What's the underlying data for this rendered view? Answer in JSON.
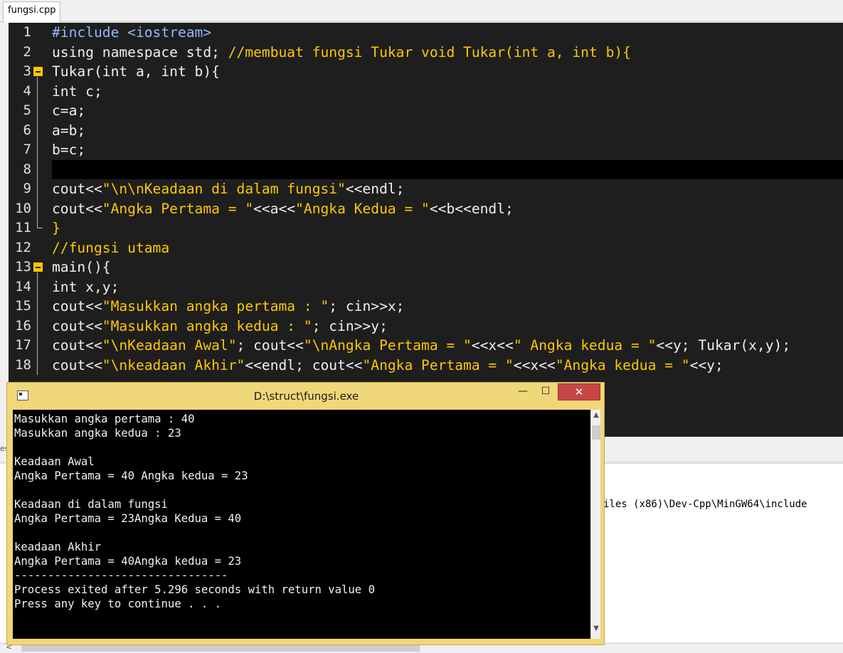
{
  "ide": {
    "tab_label": "fungsi.cpp",
    "lines": [
      {
        "n": "1",
        "parts": [
          [
            "kw",
            "#include <iostream>"
          ]
        ]
      },
      {
        "n": "2",
        "parts": [
          [
            "",
            "using namespace std; "
          ],
          [
            "cmt",
            "//membuat fungsi Tukar void Tukar(int a, int b){"
          ]
        ]
      },
      {
        "n": "3",
        "parts": [
          [
            "",
            "Tukar(int a, int b){"
          ]
        ],
        "fold": "open"
      },
      {
        "n": "4",
        "parts": [
          [
            "",
            "int c;"
          ]
        ]
      },
      {
        "n": "5",
        "parts": [
          [
            "",
            "c=a;"
          ]
        ]
      },
      {
        "n": "6",
        "parts": [
          [
            "",
            "a=b;"
          ]
        ]
      },
      {
        "n": "7",
        "parts": [
          [
            "",
            "b=c;"
          ]
        ]
      },
      {
        "n": "8",
        "parts": [
          [
            "",
            ""
          ]
        ],
        "active": true
      },
      {
        "n": "9",
        "parts": [
          [
            "",
            "cout<<"
          ],
          [
            "str",
            "\"\\n\\nKeadaan di dalam fungsi\""
          ],
          [
            "",
            "<<endl;"
          ]
        ]
      },
      {
        "n": "10",
        "parts": [
          [
            "",
            "cout<<"
          ],
          [
            "str",
            "\"Angka Pertama = \""
          ],
          [
            "",
            "<<a<<"
          ],
          [
            "str",
            "\"Angka Kedua = \""
          ],
          [
            "",
            "<<b<<endl;"
          ]
        ]
      },
      {
        "n": "11",
        "parts": [
          [
            "str",
            "}"
          ]
        ],
        "fold": "end"
      },
      {
        "n": "12",
        "parts": [
          [
            "cmt",
            "//fungsi utama"
          ]
        ]
      },
      {
        "n": "13",
        "parts": [
          [
            "",
            "main(){"
          ]
        ],
        "fold": "open"
      },
      {
        "n": "14",
        "parts": [
          [
            "",
            "int x,y;"
          ]
        ]
      },
      {
        "n": "15",
        "parts": [
          [
            "",
            "cout<<"
          ],
          [
            "str",
            "\"Masukkan angka pertama : \""
          ],
          [
            "",
            "; cin>>x;"
          ]
        ]
      },
      {
        "n": "16",
        "parts": [
          [
            "",
            "cout<<"
          ],
          [
            "str",
            "\"Masukkan angka kedua : \""
          ],
          [
            "",
            "; cin>>y;"
          ]
        ]
      },
      {
        "n": "17",
        "parts": [
          [
            "",
            "cout<<"
          ],
          [
            "str",
            "\"\\nKeadaan Awal\""
          ],
          [
            "",
            "; cout<<"
          ],
          [
            "str",
            "\"\\nAngka Pertama = \""
          ],
          [
            "",
            "<<x<<"
          ],
          [
            "str",
            "\" Angka kedua = \""
          ],
          [
            "",
            "<<y; Tukar(x,y);"
          ]
        ]
      },
      {
        "n": "18",
        "parts": [
          [
            "",
            "cout<<"
          ],
          [
            "str",
            "\"\\nkeadaan Akhir\""
          ],
          [
            "",
            "<<endl; cout<<"
          ],
          [
            "str",
            "\"Angka Pertama = \""
          ],
          [
            "",
            "<<x<<"
          ],
          [
            "str",
            "\"Angka kedua = \""
          ],
          [
            "",
            "<<y;"
          ]
        ]
      }
    ],
    "log_text": "iles (x86)\\Dev-Cpp\\MinGW64\\include"
  },
  "console": {
    "title": "D:\\struct\\fungsi.exe",
    "minimize_label": "—",
    "maximize_label": "☐",
    "close_label": "✕",
    "output": [
      "Masukkan angka pertama : 40",
      "Masukkan angka kedua : 23",
      "",
      "Keadaan Awal",
      "Angka Pertama = 40 Angka kedua = 23",
      "",
      "Keadaan di dalam fungsi",
      "Angka Pertama = 23Angka Kedua = 40",
      "",
      "keadaan Akhir",
      "Angka Pertama = 40Angka kedua = 23",
      "--------------------------------",
      "Process exited after 5.296 seconds with return value 0",
      "Press any key to continue . . ."
    ]
  },
  "icons": {
    "fold_open": "fold-minus-icon",
    "console_app": "console-window-icon",
    "scroll_up": "▲",
    "scroll_down": "▼",
    "scroll_left": "<"
  },
  "colors": {
    "editor_bg": "#1e1e1e",
    "keyword": "#94b8ff",
    "string": "#ffc800",
    "console_frame": "#f0d77a",
    "close_button": "#c74646"
  }
}
